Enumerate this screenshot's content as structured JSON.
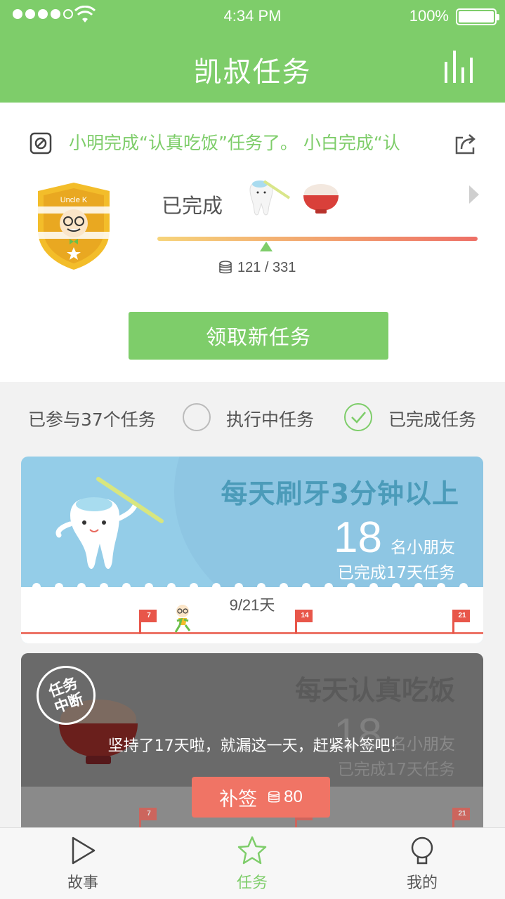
{
  "status_bar": {
    "time": "4:34 PM",
    "battery": "100%"
  },
  "header": {
    "title": "凯叔任务",
    "stats_icon": "bar-chart-icon"
  },
  "news": {
    "ticker": "小明完成“认真吃饭”任务了。   小白完成“认",
    "left_icon": "block-icon",
    "right_icon": "share-icon"
  },
  "summary": {
    "badge_text": "Uncle K",
    "completed_label": "已完成",
    "completed_icons": [
      "tooth-brush-icon",
      "rice-bowl-icon"
    ],
    "progress": {
      "current": 121,
      "total": 331,
      "text": "121 / 331"
    },
    "get_task_button": "领取新任务"
  },
  "filters": {
    "participated": "已参与37个任务",
    "in_progress": "执行中任务",
    "completed": "已完成任务",
    "in_progress_checked": false,
    "completed_checked": true
  },
  "tasks": [
    {
      "title": "每天刷牙3分钟以上",
      "kids_count": "18",
      "kids_label": "名小朋友",
      "days_done": "已完成17天任务",
      "progress_label": "9/21天",
      "flags": [
        "7",
        "14",
        "21"
      ],
      "accent": "#94cde8"
    },
    {
      "title": "每天认真吃饭",
      "kids_count": "18",
      "kids_label": "名小朋友",
      "days_done": "已完成17天任务",
      "status_stamp_line1": "任务",
      "status_stamp_line2": "中断",
      "message": "坚持了17天啦，就漏这一天，赶紧补签吧!",
      "makeup_label": "补签",
      "makeup_cost": "80",
      "flags": [
        "7",
        "14",
        "21"
      ]
    }
  ],
  "bottom_nav": [
    {
      "label": "故事",
      "icon": "play-icon",
      "active": false
    },
    {
      "label": "任务",
      "icon": "star-icon",
      "active": true
    },
    {
      "label": "我的",
      "icon": "profile-icon",
      "active": false
    }
  ],
  "colors": {
    "primary_green": "#7ecd6a",
    "accent_red": "#f07465",
    "card_blue": "#94cde8"
  }
}
